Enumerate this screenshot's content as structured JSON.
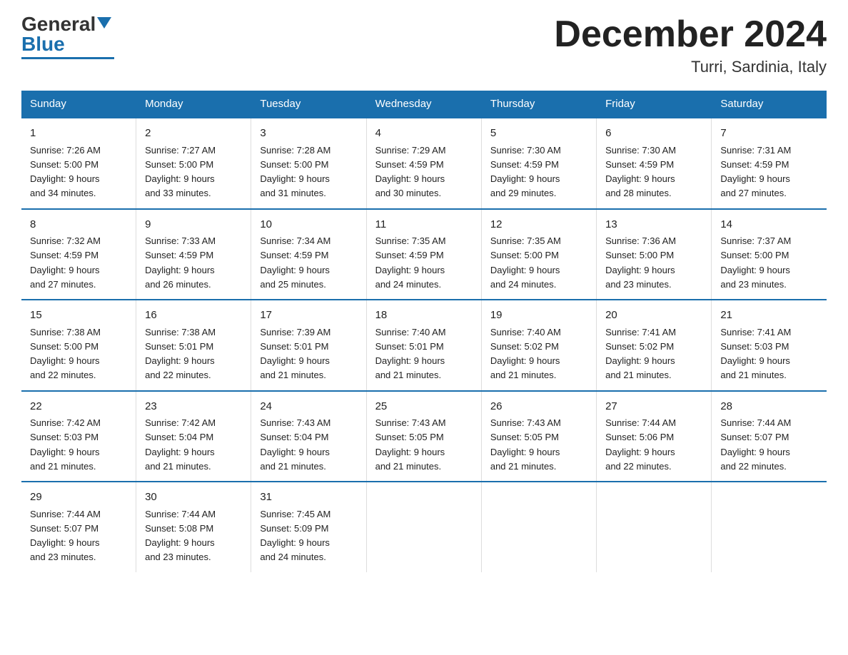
{
  "logo": {
    "general": "General",
    "blue": "Blue"
  },
  "title": "December 2024",
  "subtitle": "Turri, Sardinia, Italy",
  "days_of_week": [
    "Sunday",
    "Monday",
    "Tuesday",
    "Wednesday",
    "Thursday",
    "Friday",
    "Saturday"
  ],
  "weeks": [
    [
      {
        "num": "1",
        "sunrise": "7:26 AM",
        "sunset": "5:00 PM",
        "daylight": "9 hours and 34 minutes."
      },
      {
        "num": "2",
        "sunrise": "7:27 AM",
        "sunset": "5:00 PM",
        "daylight": "9 hours and 33 minutes."
      },
      {
        "num": "3",
        "sunrise": "7:28 AM",
        "sunset": "5:00 PM",
        "daylight": "9 hours and 31 minutes."
      },
      {
        "num": "4",
        "sunrise": "7:29 AM",
        "sunset": "4:59 PM",
        "daylight": "9 hours and 30 minutes."
      },
      {
        "num": "5",
        "sunrise": "7:30 AM",
        "sunset": "4:59 PM",
        "daylight": "9 hours and 29 minutes."
      },
      {
        "num": "6",
        "sunrise": "7:30 AM",
        "sunset": "4:59 PM",
        "daylight": "9 hours and 28 minutes."
      },
      {
        "num": "7",
        "sunrise": "7:31 AM",
        "sunset": "4:59 PM",
        "daylight": "9 hours and 27 minutes."
      }
    ],
    [
      {
        "num": "8",
        "sunrise": "7:32 AM",
        "sunset": "4:59 PM",
        "daylight": "9 hours and 27 minutes."
      },
      {
        "num": "9",
        "sunrise": "7:33 AM",
        "sunset": "4:59 PM",
        "daylight": "9 hours and 26 minutes."
      },
      {
        "num": "10",
        "sunrise": "7:34 AM",
        "sunset": "4:59 PM",
        "daylight": "9 hours and 25 minutes."
      },
      {
        "num": "11",
        "sunrise": "7:35 AM",
        "sunset": "4:59 PM",
        "daylight": "9 hours and 24 minutes."
      },
      {
        "num": "12",
        "sunrise": "7:35 AM",
        "sunset": "5:00 PM",
        "daylight": "9 hours and 24 minutes."
      },
      {
        "num": "13",
        "sunrise": "7:36 AM",
        "sunset": "5:00 PM",
        "daylight": "9 hours and 23 minutes."
      },
      {
        "num": "14",
        "sunrise": "7:37 AM",
        "sunset": "5:00 PM",
        "daylight": "9 hours and 23 minutes."
      }
    ],
    [
      {
        "num": "15",
        "sunrise": "7:38 AM",
        "sunset": "5:00 PM",
        "daylight": "9 hours and 22 minutes."
      },
      {
        "num": "16",
        "sunrise": "7:38 AM",
        "sunset": "5:01 PM",
        "daylight": "9 hours and 22 minutes."
      },
      {
        "num": "17",
        "sunrise": "7:39 AM",
        "sunset": "5:01 PM",
        "daylight": "9 hours and 21 minutes."
      },
      {
        "num": "18",
        "sunrise": "7:40 AM",
        "sunset": "5:01 PM",
        "daylight": "9 hours and 21 minutes."
      },
      {
        "num": "19",
        "sunrise": "7:40 AM",
        "sunset": "5:02 PM",
        "daylight": "9 hours and 21 minutes."
      },
      {
        "num": "20",
        "sunrise": "7:41 AM",
        "sunset": "5:02 PM",
        "daylight": "9 hours and 21 minutes."
      },
      {
        "num": "21",
        "sunrise": "7:41 AM",
        "sunset": "5:03 PM",
        "daylight": "9 hours and 21 minutes."
      }
    ],
    [
      {
        "num": "22",
        "sunrise": "7:42 AM",
        "sunset": "5:03 PM",
        "daylight": "9 hours and 21 minutes."
      },
      {
        "num": "23",
        "sunrise": "7:42 AM",
        "sunset": "5:04 PM",
        "daylight": "9 hours and 21 minutes."
      },
      {
        "num": "24",
        "sunrise": "7:43 AM",
        "sunset": "5:04 PM",
        "daylight": "9 hours and 21 minutes."
      },
      {
        "num": "25",
        "sunrise": "7:43 AM",
        "sunset": "5:05 PM",
        "daylight": "9 hours and 21 minutes."
      },
      {
        "num": "26",
        "sunrise": "7:43 AM",
        "sunset": "5:05 PM",
        "daylight": "9 hours and 21 minutes."
      },
      {
        "num": "27",
        "sunrise": "7:44 AM",
        "sunset": "5:06 PM",
        "daylight": "9 hours and 22 minutes."
      },
      {
        "num": "28",
        "sunrise": "7:44 AM",
        "sunset": "5:07 PM",
        "daylight": "9 hours and 22 minutes."
      }
    ],
    [
      {
        "num": "29",
        "sunrise": "7:44 AM",
        "sunset": "5:07 PM",
        "daylight": "9 hours and 23 minutes."
      },
      {
        "num": "30",
        "sunrise": "7:44 AM",
        "sunset": "5:08 PM",
        "daylight": "9 hours and 23 minutes."
      },
      {
        "num": "31",
        "sunrise": "7:45 AM",
        "sunset": "5:09 PM",
        "daylight": "9 hours and 24 minutes."
      },
      null,
      null,
      null,
      null
    ]
  ],
  "labels": {
    "sunrise": "Sunrise:",
    "sunset": "Sunset:",
    "daylight": "Daylight:"
  }
}
